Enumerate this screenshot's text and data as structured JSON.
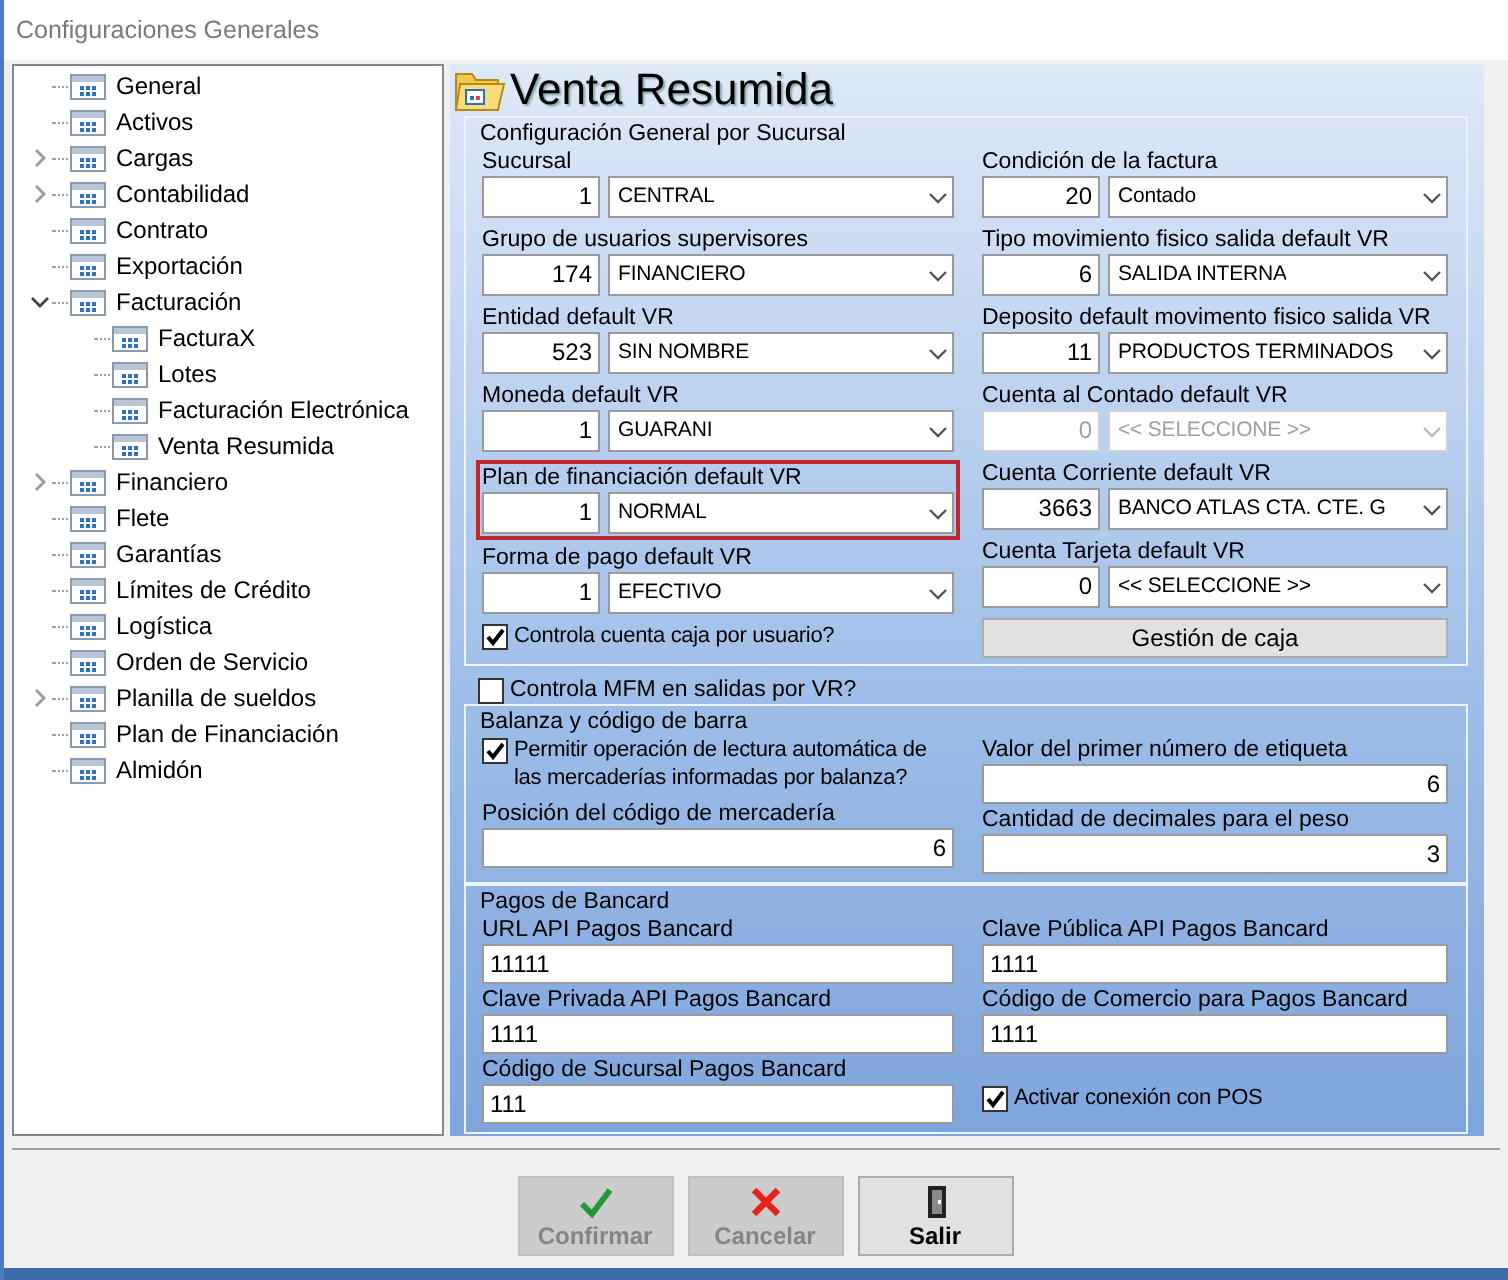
{
  "window": {
    "title": "Configuraciones Generales"
  },
  "tree": [
    {
      "label": "General",
      "selected": false
    },
    {
      "label": "Activos",
      "selected": false
    },
    {
      "label": "Cargas",
      "selected": false,
      "expanded": false
    },
    {
      "label": "Contabilidad",
      "selected": false,
      "expanded": false
    },
    {
      "label": "Contrato",
      "selected": false
    },
    {
      "label": "Exportación",
      "selected": false
    },
    {
      "label": "Facturación",
      "selected": false,
      "expanded": true,
      "children": [
        {
          "label": "FacturaX",
          "selected": false
        },
        {
          "label": "Lotes",
          "selected": false
        },
        {
          "label": "Facturación Electrónica",
          "selected": false
        },
        {
          "label": "Venta Resumida",
          "selected": false
        }
      ]
    },
    {
      "label": "Financiero",
      "selected": false,
      "expanded": false
    },
    {
      "label": "Flete",
      "selected": false
    },
    {
      "label": "Garantías",
      "selected": false
    },
    {
      "label": "Límites de Crédito",
      "selected": false
    },
    {
      "label": "Logística",
      "selected": false
    },
    {
      "label": "Orden de Servicio",
      "selected": false
    },
    {
      "label": "Planilla de sueldos",
      "selected": false,
      "expanded": false
    },
    {
      "label": "Plan de Financiación",
      "selected": false
    },
    {
      "label": "Almidón",
      "selected": false
    }
  ],
  "page": {
    "title": "Venta Resumida"
  },
  "sections": [
    {
      "kind": "group",
      "title": "Configuración General por Sucursal",
      "columns": [
        [
          {
            "kind": "combo",
            "label": "Sucursal",
            "code": "1",
            "option": "CENTRAL",
            "disabled": false,
            "highlighted": false
          },
          {
            "kind": "combo",
            "label": "Grupo de usuarios supervisores",
            "code": "174",
            "option": "FINANCIERO",
            "disabled": false,
            "highlighted": false
          },
          {
            "kind": "combo",
            "label": "Entidad default VR",
            "code": "523",
            "option": "SIN NOMBRE",
            "disabled": false,
            "highlighted": false
          },
          {
            "kind": "combo",
            "label": "Moneda default VR",
            "code": "1",
            "option": "GUARANI",
            "disabled": false,
            "highlighted": false
          },
          {
            "kind": "combo",
            "label": "Plan de financiación default VR",
            "code": "1",
            "option": "NORMAL",
            "disabled": false,
            "highlighted": true
          },
          {
            "kind": "combo",
            "label": "Forma de pago default VR",
            "code": "1",
            "option": "EFECTIVO",
            "disabled": false,
            "highlighted": false
          },
          {
            "kind": "checkbox",
            "text": "Controla cuenta caja por usuario?",
            "checked": true
          }
        ],
        [
          {
            "kind": "combo",
            "label": "Condición de la factura",
            "code": "20",
            "option": "Contado",
            "disabled": false,
            "highlighted": false
          },
          {
            "kind": "combo",
            "label": "Tipo movimiento fisico salida default VR",
            "code": "6",
            "option": "SALIDA INTERNA",
            "disabled": false,
            "highlighted": false
          },
          {
            "kind": "combo",
            "label": "Deposito default movimento fisico salida VR",
            "code": "11",
            "option": "PRODUCTOS TERMINADOS",
            "disabled": false,
            "highlighted": false
          },
          {
            "kind": "combo",
            "label": "Cuenta al Contado default VR",
            "code": "0",
            "option": "<< SELECCIONE >>",
            "disabled": true,
            "highlighted": false
          },
          {
            "kind": "combo",
            "label": "Cuenta Corriente default VR",
            "code": "3663",
            "option": "BANCO ATLAS CTA. CTE. G",
            "disabled": false,
            "highlighted": false
          },
          {
            "kind": "combo",
            "label": "Cuenta Tarjeta default VR",
            "code": "0",
            "option": "<< SELECCIONE >>",
            "disabled": false,
            "highlighted": false
          },
          {
            "kind": "button",
            "label": "Gestión de caja"
          }
        ]
      ]
    },
    {
      "kind": "checkbox",
      "text": "Controla MFM en salidas por VR?",
      "checked": false
    },
    {
      "kind": "group",
      "title": "Balanza y código de barra",
      "columns": [
        [
          {
            "kind": "checkbox",
            "text": "Permitir operación de lectura automática de las mercaderías informadas por balanza?",
            "checked": true
          },
          {
            "kind": "number",
            "label": "Posición del código de mercadería",
            "value": "6"
          }
        ],
        [
          {
            "kind": "number",
            "label": "Valor del primer número de etiqueta",
            "value": "6"
          },
          {
            "kind": "number",
            "label": "Cantidad de decimales para el peso",
            "value": "3"
          }
        ]
      ]
    },
    {
      "kind": "group",
      "title": "Pagos de Bancard",
      "columns": [
        [
          {
            "kind": "text",
            "label": "URL API Pagos Bancard",
            "value": "11111"
          },
          {
            "kind": "text",
            "label": "Clave Privada API Pagos Bancard",
            "value": "1111"
          },
          {
            "kind": "text",
            "label": "Código de Sucursal Pagos Bancard",
            "value": "111"
          }
        ],
        [
          {
            "kind": "text",
            "label": "Clave Pública API Pagos Bancard",
            "value": "1111"
          },
          {
            "kind": "text",
            "label": "Código de Comercio para Pagos Bancard",
            "value": "1111"
          },
          {
            "kind": "checkbox",
            "text": "Activar conexión con POS",
            "checked": true
          }
        ]
      ]
    }
  ],
  "buttons": [
    {
      "kind": "confirm",
      "label": "Confirmar",
      "disabled": true
    },
    {
      "kind": "cancel",
      "label": "Cancelar",
      "disabled": true
    },
    {
      "kind": "exit",
      "label": "Salir",
      "disabled": false
    }
  ]
}
